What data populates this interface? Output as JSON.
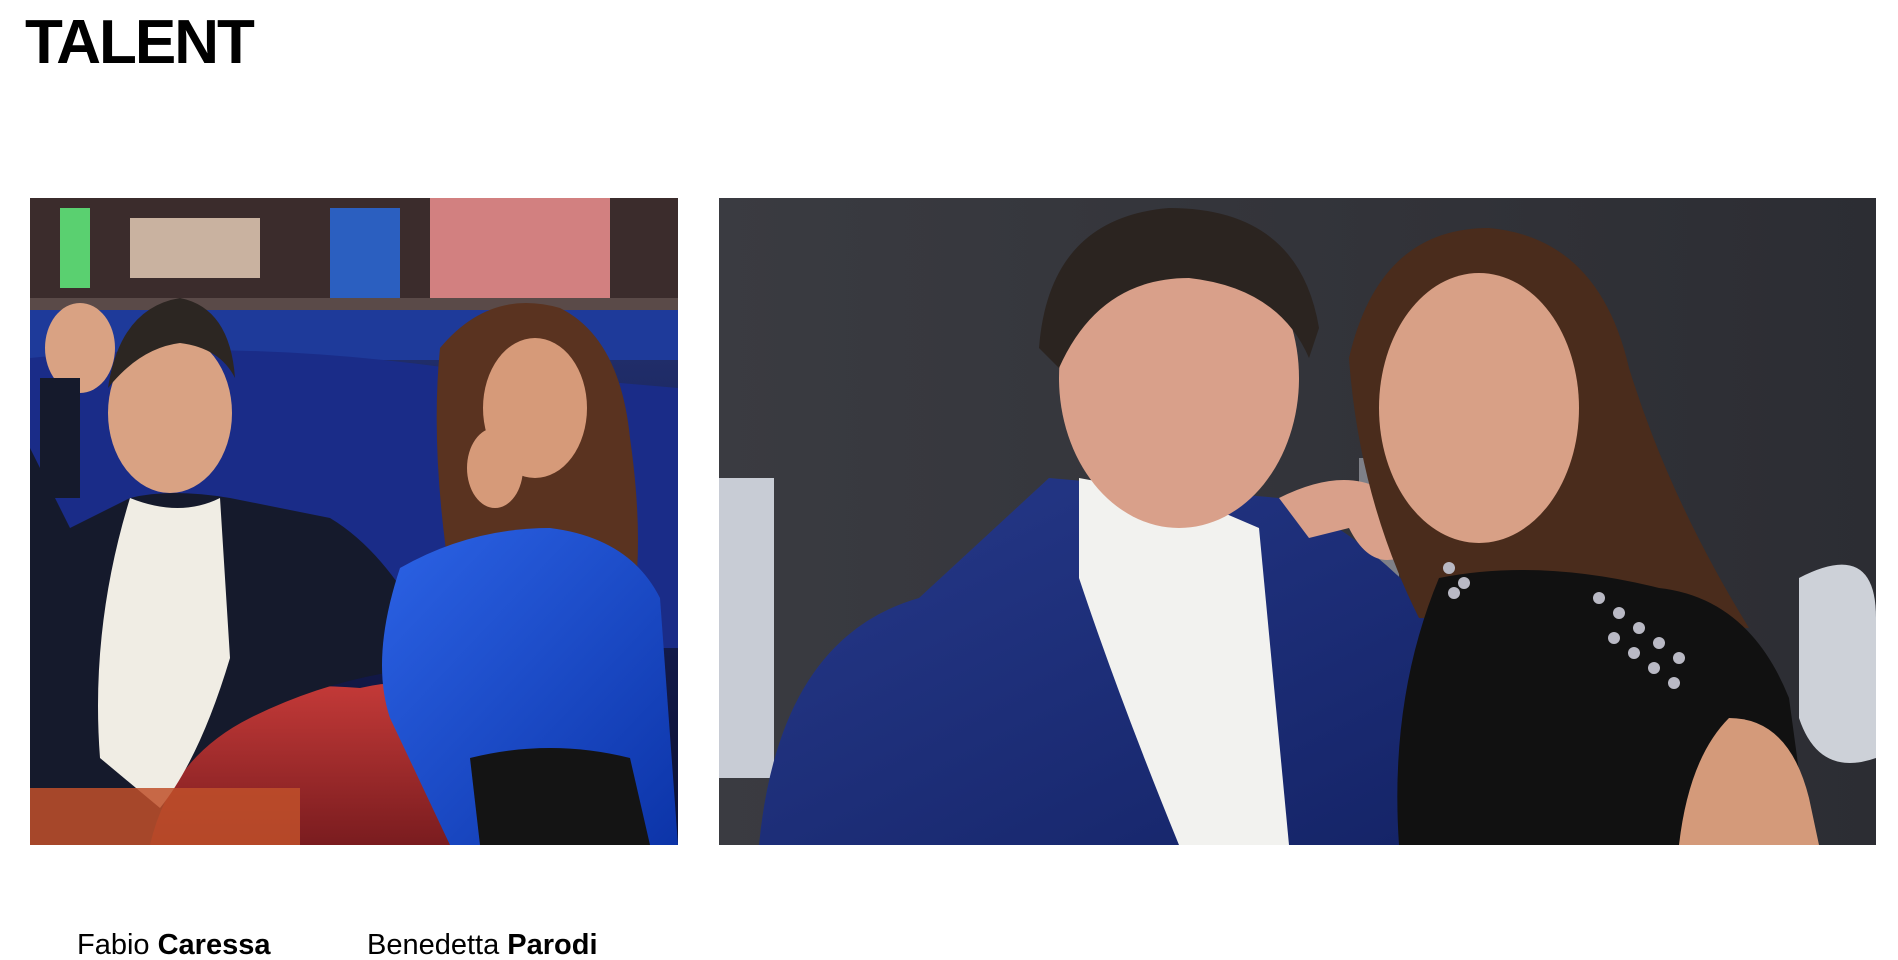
{
  "page": {
    "title": "TALENT"
  },
  "gallery": {
    "images": [
      {
        "subject": "Fabio Caressa and Benedetta Parodi seated on a red sofa in a TV studio"
      },
      {
        "subject": "Fabio Caressa and Benedetta Parodi posing together in front of a dark backdrop"
      }
    ]
  },
  "talent": [
    {
      "first_name": "Fabio",
      "last_name": "Caressa"
    },
    {
      "first_name": "Benedetta",
      "last_name": "Parodi"
    }
  ],
  "colors": {
    "text": "#000000",
    "background": "#ffffff"
  }
}
